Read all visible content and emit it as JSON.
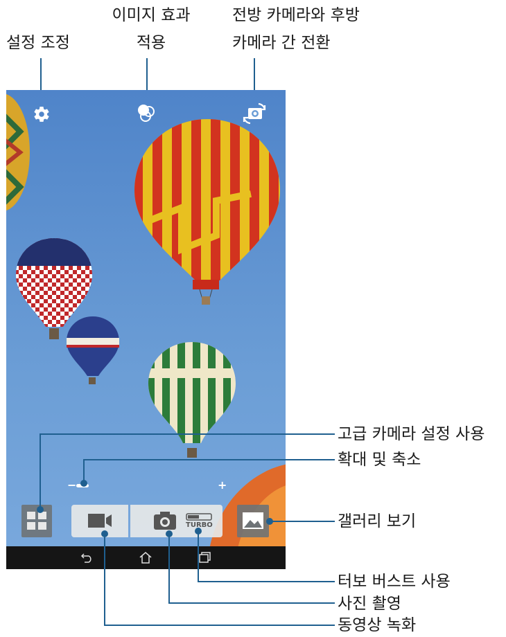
{
  "callouts": {
    "settings": "설정 조정",
    "effect_line1": "이미지 효과",
    "effect_line2": "적용",
    "switch_line1": "전방 카메라와 후방",
    "switch_line2": "카메라 간 전환",
    "advanced": "고급 카메라 설정 사용",
    "zoom": "확대 및 축소",
    "gallery": "갤러리 보기",
    "turbo": "터보 버스트 사용",
    "photo": "사진 촬영",
    "video": "동영상 녹화"
  },
  "screen": {
    "zoom_minus": "−",
    "zoom_plus": "+",
    "turbo_label": "TURBO"
  },
  "icons": [
    "gear-icon",
    "effects-icon",
    "switch-camera-icon",
    "grid-icon",
    "video-camera-icon",
    "camera-icon",
    "turbo-toggle-icon",
    "gallery-icon",
    "back-icon",
    "home-icon",
    "recent-apps-icon"
  ],
  "colors": {
    "sky": "#6c9ed6",
    "callout_line": "#1f5f8f",
    "navbar": "#151515"
  }
}
